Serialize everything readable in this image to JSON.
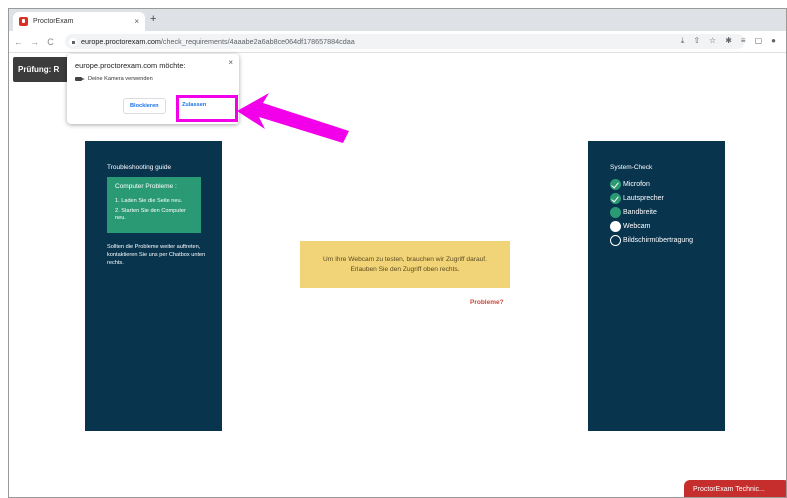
{
  "browser": {
    "tab_title": "ProctorExam",
    "tab_close": "×",
    "new_tab": "+",
    "nav": {
      "back": "←",
      "forward": "→",
      "reload": "C"
    },
    "url_host": "europe.proctorexam.com",
    "url_path": "/check_requirements/4aaabe2a6ab8ce064df178657884cdaa"
  },
  "exam_header": "Prüfung: R",
  "permission_popup": {
    "title": "europe.proctorexam.com möchte:",
    "close": "×",
    "permission": "Deine Kamera verwenden",
    "block_label": "Blockieren",
    "allow_label": "Zulassen"
  },
  "troubleshooting": {
    "title": "Troubleshooting guide",
    "box_title": "Computer Probleme :",
    "steps": [
      "1. Laden Sie die Seite neu.",
      "2. Starten Sie den Computer neu."
    ],
    "footer": "Sollten die Probleme weiter auftreten, kontaktieren Sie uns per Chatbox unten rechts."
  },
  "notice": "Um Ihre Webcam zu testen, brauchen wir Zugriff darauf. Erlauben Sie den Zugriff oben rechts.",
  "problems_link": "Probleme?",
  "system_check": {
    "title": "System-Check",
    "items": [
      {
        "label": "Microfon",
        "status": "ok"
      },
      {
        "label": "Lautsprecher",
        "status": "ok"
      },
      {
        "label": "Bandbreite",
        "status": "progress"
      },
      {
        "label": "Webcam",
        "status": "active"
      },
      {
        "label": "Bildschirmübertragung",
        "status": "pending"
      }
    ]
  },
  "tech_button": "ProctorExam Technic...",
  "colors": {
    "panel": "#08344e",
    "accent": "#2a9a74",
    "notice": "#f2d478",
    "highlight": "#f200ea",
    "link": "#c9483b"
  }
}
